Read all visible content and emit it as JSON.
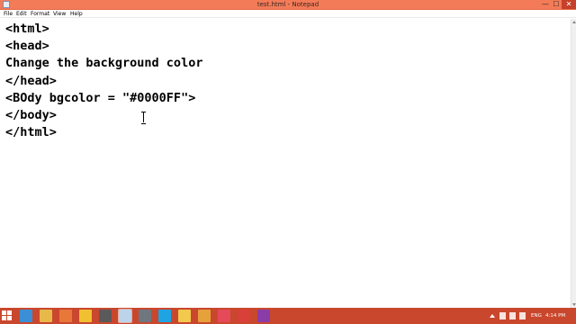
{
  "window": {
    "title": "test.html - Notepad",
    "controls": {
      "minimize": "—",
      "maximize": "☐",
      "close": "✕"
    }
  },
  "menu": [
    "File",
    "Edit",
    "Format",
    "View",
    "Help"
  ],
  "editor": {
    "lines": [
      "<html>",
      "<head>",
      "Change the background color",
      "</head>",
      "<BOdy bgcolor = \"#0000FF\">",
      "</body>",
      "</html>"
    ]
  },
  "taskbar": {
    "pinned_apps": [
      {
        "name": "ie-icon",
        "color": "#3b8fd6",
        "active": false
      },
      {
        "name": "explorer-icon",
        "color": "#e8b84a",
        "active": false
      },
      {
        "name": "media-icon",
        "color": "#e9773a",
        "active": false
      },
      {
        "name": "paint-icon",
        "color": "#f0c030",
        "active": false
      },
      {
        "name": "camera-icon",
        "color": "#5a5a5a",
        "active": false
      },
      {
        "name": "notepad-icon",
        "color": "#bcd3ea",
        "active": true
      },
      {
        "name": "calculator-icon",
        "color": "#6e7780",
        "active": false
      },
      {
        "name": "skype-icon",
        "color": "#1ea4e3",
        "active": false
      },
      {
        "name": "folder-icon",
        "color": "#f2c94c",
        "active": false
      },
      {
        "name": "chrome-icon",
        "color": "#e5a23a",
        "active": false
      },
      {
        "name": "snipping-icon",
        "color": "#e44a5a",
        "active": false
      },
      {
        "name": "ccleaner-icon",
        "color": "#d9403a",
        "active": false
      },
      {
        "name": "onenote-icon",
        "color": "#8a3ca8",
        "active": false
      }
    ],
    "language": "ENG",
    "clock": "4:14 PM"
  }
}
